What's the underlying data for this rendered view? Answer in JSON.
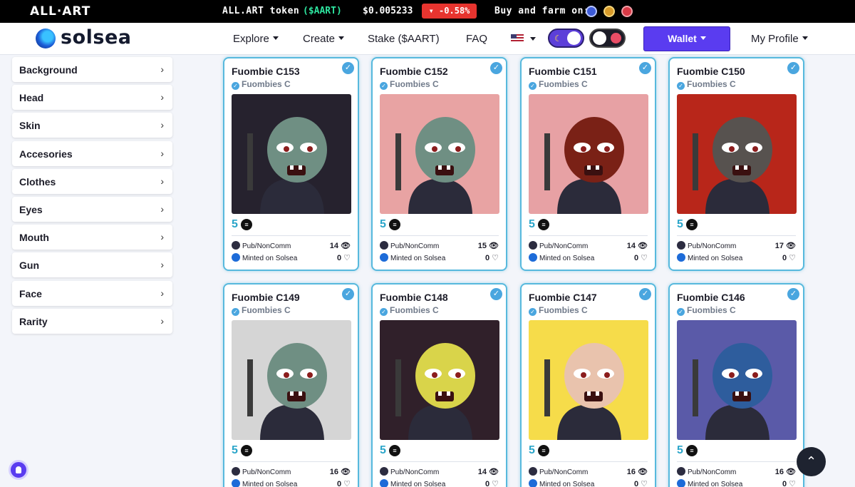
{
  "topbar": {
    "logo": "ALL·ART",
    "token_label": "ALL.ART token",
    "ticker": "($AART)",
    "price": "$0.005233",
    "change": "▾ -0.58%",
    "change_color": "#e7342f",
    "buy_farm": "Buy and farm on:"
  },
  "nav": {
    "brand": "solsea",
    "links": [
      "Explore",
      "Create",
      "Stake ($AART)",
      "FAQ"
    ],
    "wallet": "Wallet",
    "profile": "My Profile",
    "accent": "#5a3cf0"
  },
  "filters": [
    "Background",
    "Head",
    "Skin",
    "Accesories",
    "Clothes",
    "Eyes",
    "Mouth",
    "Gun",
    "Face",
    "Rarity"
  ],
  "cards": [
    {
      "name": "Fuombie C153",
      "collection": "Fuombies C",
      "price": "5",
      "license": "Pub/NonComm",
      "minted": "Minted on Solsea",
      "views": "14",
      "likes": "0",
      "bg": "#26222e",
      "skin": "#6f8f83"
    },
    {
      "name": "Fuombie C152",
      "collection": "Fuombies C",
      "price": "5",
      "license": "Pub/NonComm",
      "minted": "Minted on Solsea",
      "views": "15",
      "likes": "0",
      "bg": "#e8a3a3",
      "skin": "#6f8f83"
    },
    {
      "name": "Fuombie C151",
      "collection": "Fuombies C",
      "price": "5",
      "license": "Pub/NonComm",
      "minted": "Minted on Solsea",
      "views": "14",
      "likes": "0",
      "bg": "#e7a1a4",
      "skin": "#7a2116"
    },
    {
      "name": "Fuombie C150",
      "collection": "Fuombies C",
      "price": "5",
      "license": "Pub/NonComm",
      "minted": "Minted on Solsea",
      "views": "17",
      "likes": "0",
      "bg": "#b8261a",
      "skin": "#57524f"
    },
    {
      "name": "Fuombie C149",
      "collection": "Fuombies C",
      "price": "5",
      "license": "Pub/NonComm",
      "minted": "Minted on Solsea",
      "views": "16",
      "likes": "0",
      "bg": "#d5d5d5",
      "skin": "#6f8f83"
    },
    {
      "name": "Fuombie C148",
      "collection": "Fuombies C",
      "price": "5",
      "license": "Pub/NonComm",
      "minted": "Minted on Solsea",
      "views": "14",
      "likes": "0",
      "bg": "#30202a",
      "skin": "#d9d44a"
    },
    {
      "name": "Fuombie C147",
      "collection": "Fuombies C",
      "price": "5",
      "license": "Pub/NonComm",
      "minted": "Minted on Solsea",
      "views": "16",
      "likes": "0",
      "bg": "#f6dc4a",
      "skin": "#e9c3ad"
    },
    {
      "name": "Fuombie C146",
      "collection": "Fuombies C",
      "price": "5",
      "license": "Pub/NonComm",
      "minted": "Minted on Solsea",
      "views": "16",
      "likes": "0",
      "bg": "#5a5aa8",
      "skin": "#2e5d9d"
    }
  ]
}
